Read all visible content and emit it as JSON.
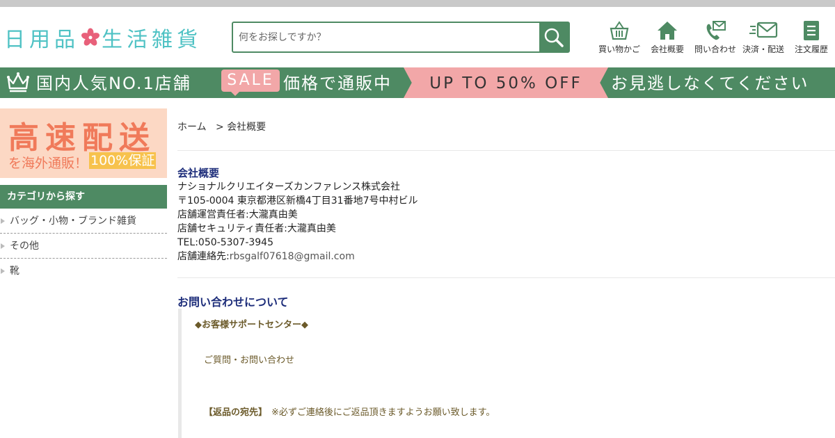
{
  "header": {
    "logo_left": "日用品",
    "logo_right": "生活雑貨",
    "search_placeholder": "何をお探しですか？",
    "nav": [
      {
        "label": "買い物かご",
        "icon": "basket-icon"
      },
      {
        "label": "会社概要",
        "icon": "home-icon"
      },
      {
        "label": "問い合わせ",
        "icon": "phone-mail-icon"
      },
      {
        "label": "決済・配送",
        "icon": "fast-delivery-icon"
      },
      {
        "label": "注文履歴",
        "icon": "order-history-icon"
      }
    ]
  },
  "banner": {
    "part1": "国内人気NO.1店舗",
    "sale": "SALE",
    "part2": "価格で通販中",
    "upto": "UP TO 50% OFF",
    "part3": "お見逃しなくてください"
  },
  "sidebar": {
    "promo_big": "高速配送",
    "promo_small": "を海外通販！",
    "promo_highlight": "100%保証",
    "category_heading": "カテゴリから探す",
    "categories": [
      "バッグ・小物・ブランド雑貨",
      "その他",
      "靴"
    ]
  },
  "breadcrumb": {
    "home": "ホーム",
    "current": "会社概要"
  },
  "company": {
    "title": "会社概要",
    "name": "ナショナルクリエイターズカンファレンス株式会社",
    "address": "〒105-0004 東京都港区新橋4丁目31番地7号中村ビル",
    "manager": "店舗運営責任者:大瀧真由美",
    "security": "店舗セキュリティ責任者:大瀧真由美",
    "tel": "TEL:050-5307-3945",
    "contact_label": "店舗連絡先:",
    "email": "rbsgalf07618@gmail.com"
  },
  "contact": {
    "title": "お問い合わせについて",
    "support_center": "◆お客様サポートセンター◆",
    "inquiry_link": "ご質問・お問い合わせ",
    "return_label": "【返品の宛先】",
    "return_note": "※必ずご連絡後にご返品頂きますようお願い致します。"
  },
  "colors": {
    "brand_green": "#4e8a63",
    "logo_teal": "#4fc2c4",
    "sale_pink": "#f2a7a8",
    "promo_orange": "#f07a5a",
    "heading_navy": "#1d2d7a"
  }
}
